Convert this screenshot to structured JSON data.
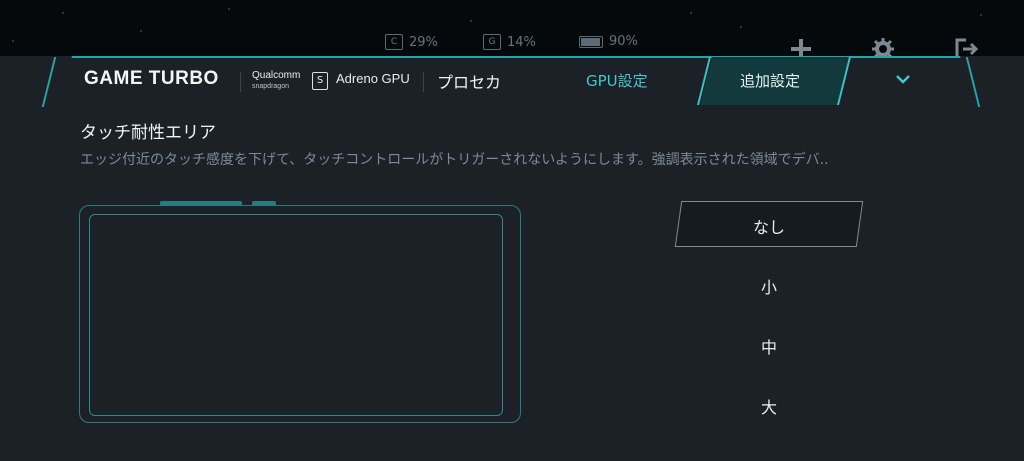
{
  "status": {
    "cpu": {
      "icon_letter": "C",
      "value": "29%"
    },
    "gpu": {
      "icon_letter": "G",
      "value": "14%"
    },
    "battery": {
      "value": "90%"
    }
  },
  "top_icons": [
    "plus-icon",
    "gear-icon",
    "exit-icon"
  ],
  "header": {
    "brand": "GAME TURBO",
    "chip_brand": "Qualcomm",
    "chip_sub": "snapdragon",
    "sd_letter": "S",
    "gpu_name": "Adreno GPU",
    "game_name": "プロセカ"
  },
  "tabs": [
    {
      "label": "GPU設定",
      "active": false
    },
    {
      "label": "追加設定",
      "active": true
    }
  ],
  "section": {
    "title": "タッチ耐性エリア",
    "description": "エッジ付近のタッチ感度を下げて、タッチコントロールがトリガーされないようにします。強調表示された領域でデバ.."
  },
  "options": {
    "items": [
      "なし",
      "小",
      "中",
      "大"
    ],
    "selected": "なし"
  },
  "colors": {
    "accent": "#3cc1c4",
    "panel": "#1c2128",
    "background": "#0b0f13"
  }
}
